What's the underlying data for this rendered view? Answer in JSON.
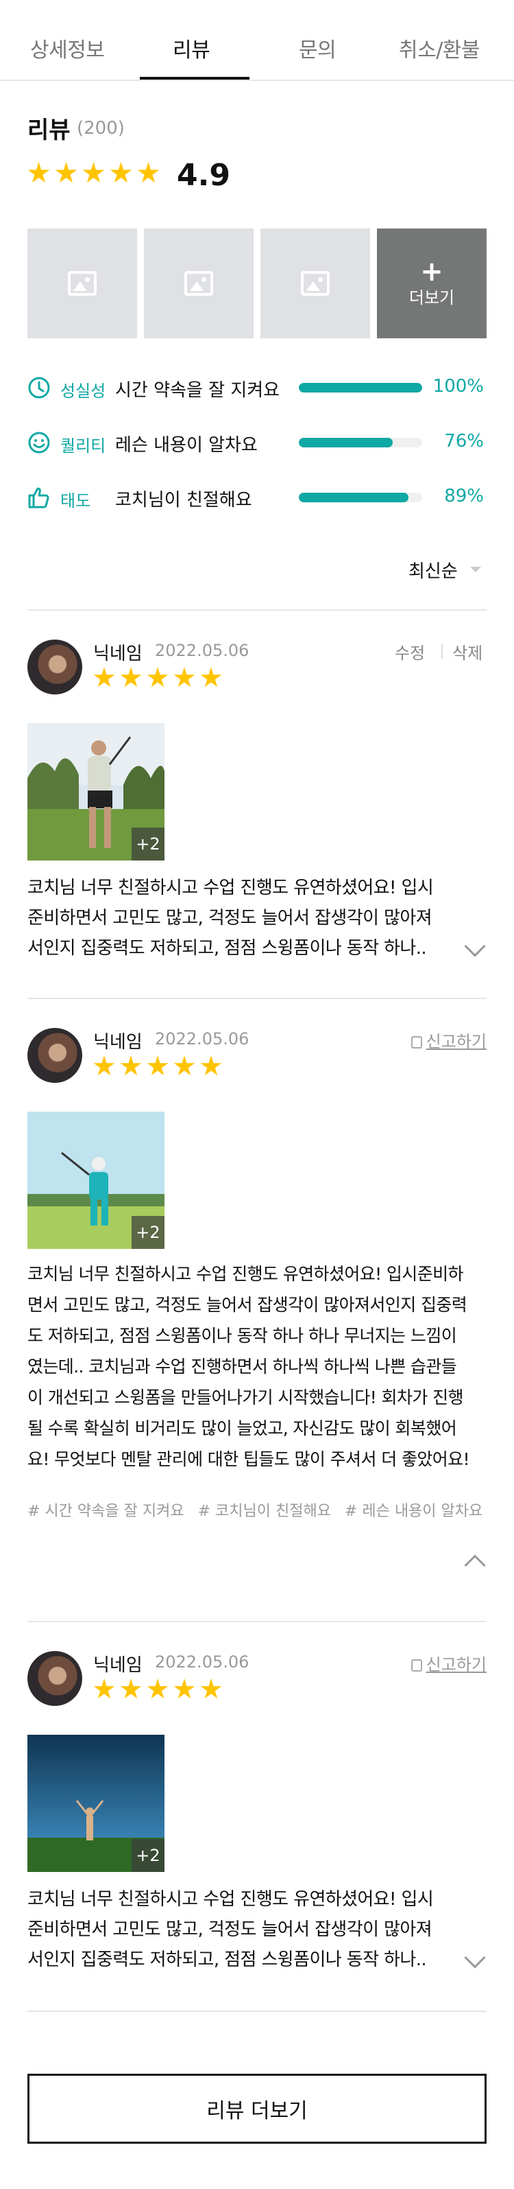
{
  "tabs": [
    "상세정보",
    "리뷰",
    "문의",
    "취소/환불"
  ],
  "active_tab": "리뷰",
  "summary": {
    "title": "리뷰",
    "count": "(200)",
    "rating": "4.9",
    "star_count": 5,
    "more_label": "더보기",
    "more_plus": "+"
  },
  "criteria": [
    {
      "icon": "clock-icon",
      "name": "성실성",
      "text": "시간 약속을 잘 지켜요",
      "percent": "100%",
      "value": 1.0
    },
    {
      "icon": "smile-icon",
      "name": "퀄리티",
      "text": "레슨 내용이 알차요",
      "percent": "76%",
      "value": 0.76
    },
    {
      "icon": "thumbs-up-icon",
      "name": "태도",
      "text": "코치님이 친절해요",
      "percent": "89%",
      "value": 0.89
    }
  ],
  "sort": {
    "label": "최신순"
  },
  "reviews": [
    {
      "nickname": "닉네임",
      "date": "2022.05.06",
      "stars": 5,
      "edit": "수정",
      "delete": "삭제",
      "photo_badge": "+2",
      "text": "코치님 너무 친절하시고 수업 진행도 유연하셨어요! 입시준비하면서 고민도 많고, 걱정도 늘어서 잡생각이 많아져서인지 집중력도 저하되고, 점점 스윙폼이나 동작 하나..",
      "text_lines": [
        "코치님 너무 친절하시고 수업 진행도 유연하셨어요! 입시",
        "준비하면서 고민도 많고, 걱정도 늘어서 잡생각이 많아져",
        "서인지 집중력도 저하되고, 점점 스윙폼이나 동작 하나.."
      ]
    },
    {
      "nickname": "닉네임",
      "date": "2022.05.06",
      "stars": 5,
      "report": "신고하기",
      "photo_badge": "+2",
      "text_lines": [
        "코치님 너무 친절하시고 수업 진행도 유연하셨어요! 입시준비하",
        "면서 고민도 많고, 걱정도 늘어서 잡생각이 많아져서인지 집중력",
        "도 저하되고, 점점 스윙폼이나 동작 하나 하나 무너지는 느낌이",
        "였는데.. 코치님과 수업 진행하면서 하나씩 하나씩 나쁜 습관들",
        "이 개선되고 스윙폼을 만들어나가기 시작했습니다! 회차가 진행",
        "될 수록 확실히 비거리도 많이 늘었고, 자신감도 많이 회복했어",
        "요! 무엇보다 멘탈 관리에 대한 팁들도 많이 주셔서 더 좋았어요!"
      ],
      "tags": [
        "# 시간 약속을 잘 지켜요",
        "# 코치님이 친절해요",
        "# 레슨 내용이 알차요"
      ]
    },
    {
      "nickname": "닉네임",
      "date": "2022.05.06",
      "stars": 5,
      "report": "신고하기",
      "photo_badge": "+2",
      "text_lines": [
        "코치님 너무 친절하시고 수업 진행도 유연하셨어요! 입시",
        "준비하면서 고민도 많고, 걱정도 늘어서 잡생각이 많아져",
        "서인지 집중력도 저하되고, 점점 스윙폼이나 동작 하나.."
      ]
    }
  ],
  "load_more": "리뷰 더보기",
  "colors": {
    "accent": "#10a8a4",
    "star": "#ffc400",
    "divider": "#e6e6e6"
  }
}
